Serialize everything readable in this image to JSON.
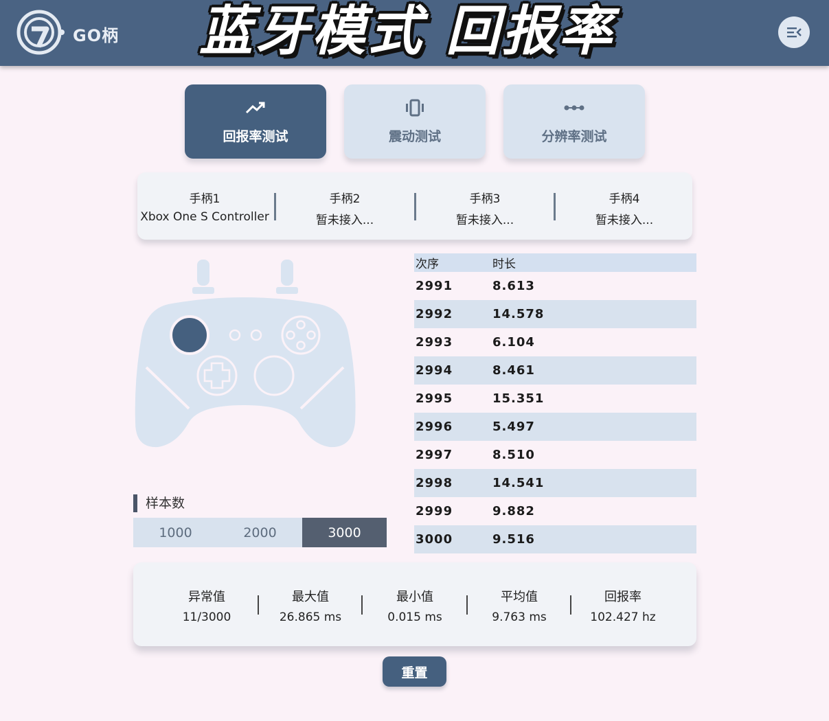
{
  "header": {
    "brand": "GO柄",
    "overlay_title": "蓝牙模式 回报率"
  },
  "tabs": [
    {
      "label": "回报率测试",
      "icon": "trending-up-icon",
      "active": true
    },
    {
      "label": "震动测试",
      "icon": "vibration-icon",
      "active": false
    },
    {
      "label": "分辨率测试",
      "icon": "dots-icon",
      "active": false
    }
  ],
  "controllers": [
    {
      "name": "手柄1",
      "status": "Xbox One S Controller"
    },
    {
      "name": "手柄2",
      "status": "暂未接入..."
    },
    {
      "name": "手柄3",
      "status": "暂未接入..."
    },
    {
      "name": "手柄4",
      "status": "暂未接入..."
    }
  ],
  "sample": {
    "title": "样本数",
    "options": [
      "1000",
      "2000",
      "3000"
    ],
    "selected": "3000"
  },
  "table": {
    "headers": [
      "次序",
      "时长"
    ],
    "rows": [
      [
        "2991",
        "8.613"
      ],
      [
        "2992",
        "14.578"
      ],
      [
        "2993",
        "6.104"
      ],
      [
        "2994",
        "8.461"
      ],
      [
        "2995",
        "15.351"
      ],
      [
        "2996",
        "5.497"
      ],
      [
        "2997",
        "8.510"
      ],
      [
        "2998",
        "14.541"
      ],
      [
        "2999",
        "9.882"
      ],
      [
        "3000",
        "9.516"
      ]
    ]
  },
  "stats": [
    {
      "label": "异常值",
      "value": "11/3000"
    },
    {
      "label": "最大值",
      "value": "26.865 ms"
    },
    {
      "label": "最小值",
      "value": "0.015 ms"
    },
    {
      "label": "平均值",
      "value": "9.763 ms"
    },
    {
      "label": "回报率",
      "value": "102.427 hz"
    }
  ],
  "reset_label": "重置",
  "colors": {
    "header": "#4a6383",
    "accent": "#45607f",
    "background": "#fbf2f8",
    "row_alt": "#d8e2ee"
  }
}
